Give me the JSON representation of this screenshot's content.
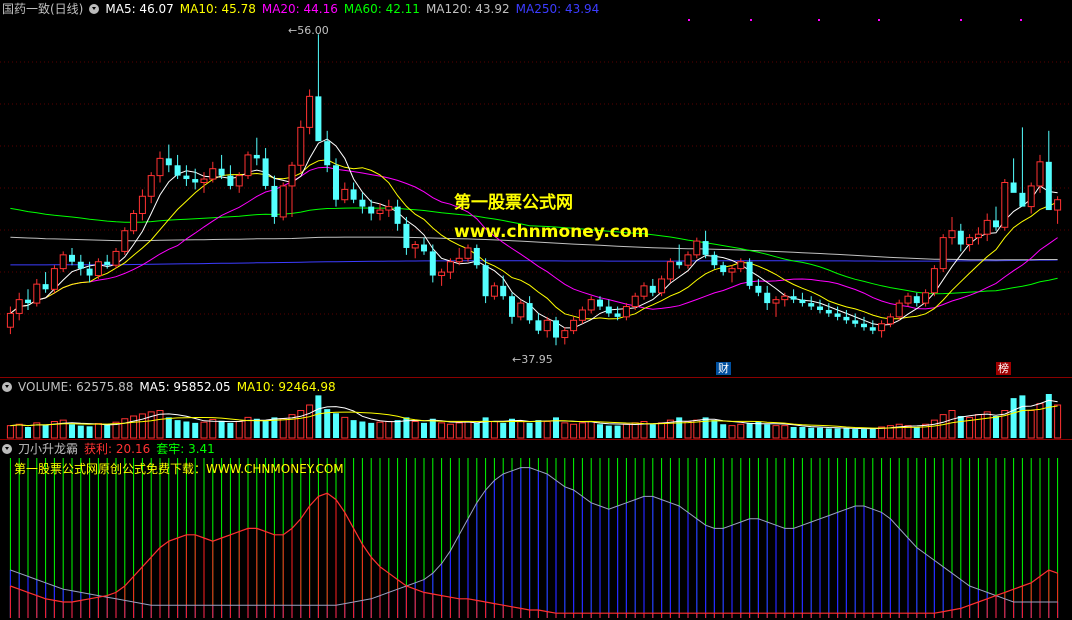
{
  "colors": {
    "up": "#ff3232",
    "down": "#54ffff",
    "ma5": "#ffffff",
    "ma10": "#ffff00",
    "ma20": "#ff00ff",
    "ma60": "#00ff00",
    "ma120": "#c0c0c0",
    "ma250": "#3c3cff",
    "bar_green": "#00ff00",
    "bar_blue": "#2626ff",
    "bar_red": "#ff2020"
  },
  "price_panel": {
    "title": "国药一致(日线)",
    "legend": [
      {
        "label": "MA5: 46.07",
        "color": "#ffffff"
      },
      {
        "label": "MA10: 45.78",
        "color": "#ffff00"
      },
      {
        "label": "MA20: 44.16",
        "color": "#ff00ff"
      },
      {
        "label": "MA60: 42.11",
        "color": "#00ff00"
      },
      {
        "label": "MA120: 43.92",
        "color": "#c0c0c0"
      },
      {
        "label": "MA250: 43.94",
        "color": "#3c3cff"
      }
    ],
    "high_label": "56.00",
    "low_label": "37.95",
    "badge_cai": "财",
    "badge_bang": "榜",
    "watermark_1": "第一股票公式网",
    "watermark_2": "www.chnmoney.com"
  },
  "volume_panel": {
    "legend": [
      {
        "label": "VOLUME: 62575.88",
        "color": "#c0c0c0"
      },
      {
        "label": "MA5: 95852.05",
        "color": "#ffffff"
      },
      {
        "label": "MA10: 92464.98",
        "color": "#ffff00"
      }
    ]
  },
  "indicator_panel": {
    "legend": [
      {
        "label": "刀小升龙霸",
        "color": "#c0c0c0"
      },
      {
        "label": "获利: 20.16",
        "color": "#ff3232"
      },
      {
        "label": "套牢: 3.41",
        "color": "#00ff00"
      }
    ],
    "subtitle": "第一股票公式网原创公式免费下载：WWW.CHNMONEY.COM"
  },
  "chart_data": {
    "type": "candlestick",
    "price_range": [
      37.95,
      56.0
    ],
    "candles": [
      [
        39.0,
        40.2,
        38.6,
        39.8
      ],
      [
        39.8,
        41.0,
        39.4,
        40.6
      ],
      [
        40.6,
        41.2,
        40.0,
        40.4
      ],
      [
        40.4,
        41.8,
        40.2,
        41.5
      ],
      [
        41.5,
        42.2,
        41.0,
        41.2
      ],
      [
        41.2,
        42.6,
        41.0,
        42.4
      ],
      [
        42.4,
        43.4,
        42.2,
        43.2
      ],
      [
        43.2,
        43.6,
        42.6,
        42.8
      ],
      [
        42.8,
        43.2,
        42.0,
        42.4
      ],
      [
        42.4,
        42.8,
        41.6,
        42.0
      ],
      [
        42.0,
        43.0,
        41.8,
        42.8
      ],
      [
        42.8,
        43.2,
        42.4,
        42.6
      ],
      [
        42.6,
        43.6,
        42.4,
        43.4
      ],
      [
        43.4,
        44.8,
        43.2,
        44.6
      ],
      [
        44.6,
        45.8,
        44.4,
        45.6
      ],
      [
        45.6,
        47.0,
        45.2,
        46.6
      ],
      [
        46.6,
        48.0,
        46.2,
        47.8
      ],
      [
        47.8,
        49.2,
        47.4,
        48.8
      ],
      [
        48.8,
        49.6,
        48.0,
        48.4
      ],
      [
        48.4,
        49.0,
        47.6,
        47.8
      ],
      [
        47.8,
        48.4,
        47.2,
        47.6
      ],
      [
        47.6,
        48.2,
        47.0,
        47.4
      ],
      [
        47.4,
        48.0,
        46.8,
        47.6
      ],
      [
        47.6,
        48.6,
        47.4,
        48.2
      ],
      [
        48.2,
        49.0,
        47.6,
        47.8
      ],
      [
        47.8,
        48.4,
        47.0,
        47.2
      ],
      [
        47.2,
        48.0,
        46.8,
        47.8
      ],
      [
        47.8,
        49.2,
        47.6,
        49.0
      ],
      [
        49.0,
        50.0,
        48.4,
        48.8
      ],
      [
        48.8,
        49.4,
        47.0,
        47.2
      ],
      [
        47.2,
        47.8,
        45.0,
        45.4
      ],
      [
        45.4,
        47.4,
        45.2,
        47.2
      ],
      [
        47.2,
        48.6,
        45.4,
        48.4
      ],
      [
        48.4,
        51.0,
        48.0,
        50.6
      ],
      [
        50.6,
        52.8,
        50.2,
        52.4
      ],
      [
        52.4,
        56.0,
        52.0,
        49.8
      ],
      [
        49.8,
        50.4,
        48.0,
        48.4
      ],
      [
        48.4,
        48.8,
        46.0,
        46.4
      ],
      [
        46.4,
        47.4,
        46.2,
        47.0
      ],
      [
        47.0,
        47.4,
        46.2,
        46.4
      ],
      [
        46.4,
        46.8,
        45.6,
        46.0
      ],
      [
        46.0,
        46.4,
        45.2,
        45.6
      ],
      [
        45.6,
        46.2,
        45.2,
        45.8
      ],
      [
        45.8,
        46.4,
        45.4,
        46.0
      ],
      [
        46.0,
        46.4,
        44.6,
        45.0
      ],
      [
        45.0,
        45.4,
        43.2,
        43.6
      ],
      [
        43.6,
        44.0,
        43.0,
        43.8
      ],
      [
        43.8,
        44.2,
        43.2,
        43.4
      ],
      [
        43.4,
        43.8,
        41.6,
        42.0
      ],
      [
        42.0,
        42.4,
        41.4,
        42.2
      ],
      [
        42.2,
        43.0,
        41.8,
        42.8
      ],
      [
        42.8,
        43.6,
        42.6,
        43.0
      ],
      [
        43.0,
        43.8,
        42.8,
        43.6
      ],
      [
        43.6,
        43.8,
        42.4,
        42.6
      ],
      [
        42.6,
        43.0,
        40.4,
        40.8
      ],
      [
        40.8,
        41.6,
        40.6,
        41.4
      ],
      [
        41.4,
        42.0,
        40.6,
        40.8
      ],
      [
        40.8,
        41.0,
        39.2,
        39.6
      ],
      [
        39.6,
        40.6,
        39.4,
        40.4
      ],
      [
        40.4,
        40.8,
        39.2,
        39.4
      ],
      [
        39.4,
        39.8,
        38.6,
        38.8
      ],
      [
        38.8,
        39.6,
        38.4,
        39.4
      ],
      [
        39.4,
        39.6,
        37.95,
        38.4
      ],
      [
        38.4,
        39.0,
        38.0,
        38.8
      ],
      [
        38.8,
        39.6,
        38.6,
        39.4
      ],
      [
        39.4,
        40.2,
        39.2,
        40.0
      ],
      [
        40.0,
        40.8,
        39.8,
        40.6
      ],
      [
        40.6,
        40.8,
        40.0,
        40.2
      ],
      [
        40.2,
        40.6,
        39.6,
        39.8
      ],
      [
        39.8,
        40.2,
        39.4,
        39.6
      ],
      [
        39.6,
        40.4,
        39.4,
        40.2
      ],
      [
        40.2,
        41.0,
        40.0,
        40.8
      ],
      [
        40.8,
        41.6,
        40.6,
        41.4
      ],
      [
        41.4,
        41.8,
        40.8,
        41.0
      ],
      [
        41.0,
        42.0,
        40.8,
        41.8
      ],
      [
        41.8,
        43.0,
        41.6,
        42.8
      ],
      [
        42.8,
        43.8,
        42.4,
        42.6
      ],
      [
        42.6,
        43.4,
        42.4,
        43.2
      ],
      [
        43.2,
        44.2,
        43.0,
        44.0
      ],
      [
        44.0,
        44.6,
        43.0,
        43.2
      ],
      [
        43.2,
        43.4,
        42.4,
        42.6
      ],
      [
        42.6,
        42.8,
        42.0,
        42.2
      ],
      [
        42.2,
        42.6,
        41.6,
        42.4
      ],
      [
        42.4,
        43.0,
        42.2,
        42.8
      ],
      [
        42.8,
        43.0,
        41.2,
        41.4
      ],
      [
        41.4,
        41.8,
        40.8,
        41.0
      ],
      [
        41.0,
        41.4,
        40.0,
        40.4
      ],
      [
        40.4,
        40.8,
        39.6,
        40.6
      ],
      [
        40.6,
        41.0,
        40.2,
        40.8
      ],
      [
        40.8,
        41.2,
        40.4,
        40.6
      ],
      [
        40.6,
        41.0,
        40.2,
        40.4
      ],
      [
        40.4,
        40.8,
        40.0,
        40.2
      ],
      [
        40.2,
        40.6,
        39.8,
        40.0
      ],
      [
        40.0,
        40.4,
        39.6,
        39.8
      ],
      [
        39.8,
        40.2,
        39.4,
        39.6
      ],
      [
        39.6,
        40.0,
        39.2,
        39.4
      ],
      [
        39.4,
        39.8,
        39.0,
        39.2
      ],
      [
        39.2,
        39.6,
        38.8,
        39.0
      ],
      [
        39.0,
        39.4,
        38.6,
        38.8
      ],
      [
        38.8,
        39.4,
        38.4,
        39.2
      ],
      [
        39.2,
        39.8,
        39.0,
        39.6
      ],
      [
        39.6,
        40.6,
        39.4,
        40.4
      ],
      [
        40.4,
        41.0,
        40.2,
        40.8
      ],
      [
        40.8,
        41.0,
        40.2,
        40.4
      ],
      [
        40.4,
        41.2,
        40.2,
        41.0
      ],
      [
        41.0,
        42.6,
        40.8,
        42.4
      ],
      [
        42.4,
        44.4,
        42.2,
        44.2
      ],
      [
        44.2,
        45.4,
        43.8,
        44.6
      ],
      [
        44.6,
        45.0,
        43.4,
        43.8
      ],
      [
        43.8,
        44.4,
        43.4,
        44.2
      ],
      [
        44.2,
        44.8,
        43.8,
        44.4
      ],
      [
        44.4,
        45.6,
        44.0,
        45.2
      ],
      [
        45.2,
        46.0,
        44.6,
        44.8
      ],
      [
        44.8,
        47.6,
        44.6,
        47.4
      ],
      [
        47.4,
        48.8,
        47.0,
        46.8
      ],
      [
        46.8,
        50.6,
        46.4,
        46.0
      ],
      [
        46.0,
        47.4,
        45.6,
        47.2
      ],
      [
        47.2,
        49.0,
        46.8,
        48.6
      ],
      [
        48.6,
        50.4,
        48.2,
        45.8
      ],
      [
        45.8,
        46.6,
        45.0,
        46.4
      ]
    ],
    "volume": [
      18,
      20,
      16,
      22,
      19,
      24,
      26,
      20,
      18,
      17,
      21,
      19,
      23,
      28,
      32,
      35,
      38,
      40,
      30,
      26,
      24,
      22,
      23,
      27,
      25,
      22,
      24,
      30,
      28,
      26,
      30,
      28,
      34,
      40,
      48,
      62,
      42,
      36,
      30,
      26,
      24,
      22,
      23,
      24,
      26,
      30,
      24,
      22,
      28,
      22,
      20,
      22,
      24,
      22,
      30,
      24,
      22,
      28,
      24,
      22,
      26,
      24,
      30,
      22,
      20,
      22,
      24,
      20,
      18,
      18,
      20,
      22,
      24,
      20,
      22,
      26,
      30,
      24,
      26,
      30,
      26,
      20,
      18,
      20,
      22,
      24,
      20,
      18,
      18,
      16,
      16,
      15,
      15,
      14,
      14,
      14,
      13,
      13,
      14,
      16,
      18,
      20,
      18,
      16,
      20,
      26,
      34,
      40,
      32,
      30,
      34,
      38,
      32,
      40,
      58,
      62,
      40,
      50,
      64,
      48
    ],
    "indicator": {
      "profit": [
        20,
        18,
        16,
        14,
        12,
        11,
        10,
        10,
        11,
        12,
        13,
        14,
        16,
        20,
        26,
        32,
        38,
        44,
        48,
        50,
        52,
        52,
        50,
        48,
        50,
        52,
        54,
        56,
        56,
        54,
        52,
        52,
        56,
        62,
        70,
        76,
        78,
        74,
        66,
        56,
        46,
        38,
        32,
        28,
        24,
        20,
        18,
        16,
        15,
        14,
        13,
        12,
        12,
        11,
        10,
        9,
        8,
        7,
        6,
        5,
        5,
        4,
        3,
        3,
        3,
        3,
        3,
        3,
        3,
        3,
        3,
        3,
        3,
        3,
        3,
        3,
        3,
        3,
        3,
        3,
        3,
        3,
        3,
        3,
        3,
        3,
        3,
        3,
        3,
        3,
        3,
        3,
        3,
        3,
        3,
        3,
        3,
        3,
        3,
        3,
        3,
        3,
        3,
        3,
        3,
        3,
        4,
        5,
        6,
        8,
        10,
        12,
        14,
        16,
        18,
        20,
        22,
        26,
        30,
        28
      ],
      "trap": [
        30,
        28,
        26,
        24,
        22,
        20,
        18,
        17,
        16,
        15,
        14,
        13,
        12,
        11,
        10,
        9,
        8,
        8,
        8,
        8,
        8,
        8,
        8,
        8,
        8,
        8,
        8,
        8,
        8,
        8,
        8,
        8,
        8,
        8,
        8,
        8,
        8,
        8,
        9,
        10,
        11,
        12,
        14,
        16,
        18,
        20,
        22,
        24,
        28,
        34,
        42,
        52,
        62,
        72,
        80,
        86,
        90,
        92,
        94,
        94,
        92,
        90,
        86,
        82,
        80,
        76,
        72,
        70,
        68,
        70,
        72,
        74,
        76,
        76,
        74,
        72,
        70,
        66,
        62,
        58,
        56,
        56,
        58,
        60,
        62,
        62,
        60,
        58,
        56,
        56,
        58,
        60,
        62,
        64,
        66,
        68,
        70,
        70,
        68,
        66,
        62,
        56,
        50,
        44,
        40,
        36,
        32,
        28,
        24,
        20,
        18,
        16,
        14,
        12,
        10,
        10,
        10,
        10,
        10,
        10
      ]
    }
  }
}
